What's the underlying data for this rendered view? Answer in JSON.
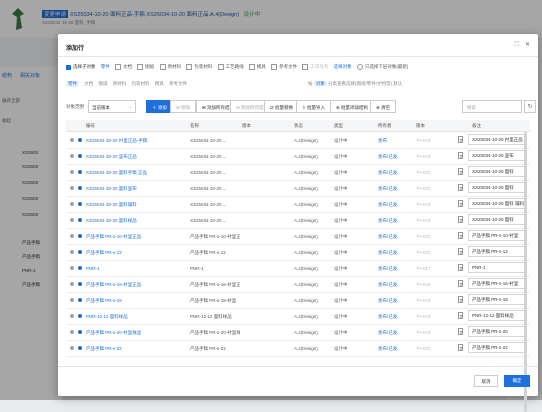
{
  "background": {
    "title_tag": "变更申请",
    "title": "XS25034-10-20 面料正品-手稿 XS25034-10-20 面料正品.A.4(Design)",
    "title_status": "设计中",
    "subtitle": "XS25034-10-20 面料_手稿",
    "side_tabs": [
      "结构",
      "相关对象"
    ],
    "side_rows": [
      "展开全部",
      "收起"
    ],
    "tree_items": [
      "XS2503",
      "XS2503",
      "XS2503",
      "XS2503",
      "XS2503",
      "产品手稿",
      "产品手稿",
      "PNR-1",
      "产品手稿"
    ]
  },
  "dialog": {
    "title": "添加行",
    "ctrl_expand": "⛶",
    "ctrl_close": "✕",
    "options": {
      "primary_check": "选择子对象",
      "active_item": "零件",
      "items": [
        "文档",
        "图纸",
        "原材料",
        "包装材料",
        "工艺路线",
        "模具",
        "参考文件",
        "工作任务"
      ],
      "link": "选择对象",
      "tail": "只选择下层对象(最新)"
    },
    "modes": {
      "selected": "零件",
      "items": [
        "文档",
        "图纸",
        "原材料",
        "包装材料",
        "模具",
        "参考文件"
      ],
      "hint_prefix": "按",
      "hint_hl": "对象",
      "hint_rest": "分类查看选择(图纸/零件/文档等) 默认"
    },
    "toolbar": {
      "scope_label": "对象范围",
      "scope_value": "当前版本",
      "add": "添加",
      "remove": "移除",
      "add_all": "添加所有结构",
      "remove_all": "移除所有结构",
      "replace": "批量替换",
      "import": "批量导入",
      "export": "批量添加结构",
      "clear": "清空",
      "search_placeholder": "搜索",
      "refresh": "↻"
    },
    "columns": [
      "编号",
      "名称",
      "版本",
      "状态",
      "类型",
      "所有者",
      "版本",
      "备注"
    ],
    "rows": [
      {
        "code": "XS25034-10-20 衬里正品-手稿",
        "name": "XS25034-10-20 ...",
        "ver": "A.4(Design)",
        "type": "设计中",
        "status": "发布",
        "vercol": "TV-019",
        "fill": "XS25034-10-20 衬里正品"
      },
      {
        "code": "XS25034-10-20 里布正品",
        "name": "XS25034-10-20 ...",
        "ver": "A.4(Design)",
        "type": "设计中",
        "status": "发布/已发",
        "vercol": "TV-019",
        "fill": "XS25034-10-20 里布"
      },
      {
        "code": "XS25034-10-20 面料手稿 正品",
        "name": "XS25034-10-20 ...",
        "ver": "A.4(Design)",
        "type": "设计中",
        "status": "发布/已发",
        "vercol": "TV-001",
        "fill": "XS25034-10-20 面料"
      },
      {
        "code": "XS25034-10-20 面料里布",
        "name": "XS25034-10-20 ...",
        "ver": "A.4(Design)",
        "type": "设计中",
        "status": "发布/已发",
        "vercol": "TV-001",
        "fill": "XS25034-10-20 面料"
      },
      {
        "code": "XS25034-10-20 面料辅料",
        "name": "XS25034-10-20 ...",
        "ver": "A.4(Design)",
        "type": "设计中",
        "status": "发布/已发",
        "vercol": "TV-019",
        "fill": "XS25034-10-20 面料 辅料"
      },
      {
        "code": "XS25034-10-20 面料样品",
        "name": "XS25034-10-20 ...",
        "ver": "A.4(Design)",
        "type": "设计中",
        "status": "发布/已发",
        "vercol": "TV-019",
        "fill": "XS25034-10-20 面料"
      },
      {
        "code": "产品手稿 PR-s-10-衬里正品",
        "name": "产品手稿 PR-s-10-衬里正品",
        "ver": "A.4(Design)",
        "type": "设计中",
        "status": "发布/已发",
        "vercol": "TV-001",
        "fill": "产品手稿 PR-s-10-衬里"
      },
      {
        "code": "产品手稿 PR-s-12",
        "name": "产品手稿 PR-s-12",
        "ver": "A.4(Design)",
        "type": "设计中",
        "status": "发布/已发",
        "vercol": "TV-001",
        "fill": "产品手稿 PR-s-12"
      },
      {
        "code": "PNR-1",
        "name": "PNR-1",
        "ver": "A.4(Design)",
        "type": "设计中",
        "status": "发布/已发",
        "vercol": "TV-017",
        "fill": "PNR-1"
      },
      {
        "code": "产品手稿 PR-s-16-衬里正品",
        "name": "产品手稿 PR-s-16-衬里正品",
        "ver": "A.4(Design)",
        "type": "设计中",
        "status": "发布/已发",
        "vercol": "TV-018",
        "fill": "产品手稿 PR-s-16-衬里"
      },
      {
        "code": "产品手稿 PR-s-18",
        "name": "产品手稿 PR-s-18-衬里",
        "ver": "A.4(Design)",
        "type": "设计中",
        "status": "发布/已发",
        "vercol": "TV-019",
        "fill": "产品手稿 PR-s-18"
      },
      {
        "code": "PNR-12-12 面料样品",
        "name": "PNR-12-12 面料样品",
        "ver": "A.4(Design)",
        "type": "设计中",
        "status": "发布/已发",
        "vercol": "TV-019",
        "fill": "PNR-12-12 面料样品"
      },
      {
        "code": "产品手稿 PR-s-20-衬里样品",
        "name": "产品手稿 PR-s-20-衬里样品",
        "ver": "A.4(Design)",
        "type": "设计中",
        "status": "发布/已发",
        "vercol": "TV-019",
        "fill": "产品手稿 PR-s-20"
      },
      {
        "code": "产品手稿 PR-s-22",
        "name": "产品手稿 PR-s-22",
        "ver": "A.4(Design)",
        "type": "设计中",
        "status": "发布/已发",
        "vercol": "TV-001",
        "fill": "产品手稿 PR-s-22"
      }
    ],
    "cancel": "取消",
    "ok": "确定"
  }
}
